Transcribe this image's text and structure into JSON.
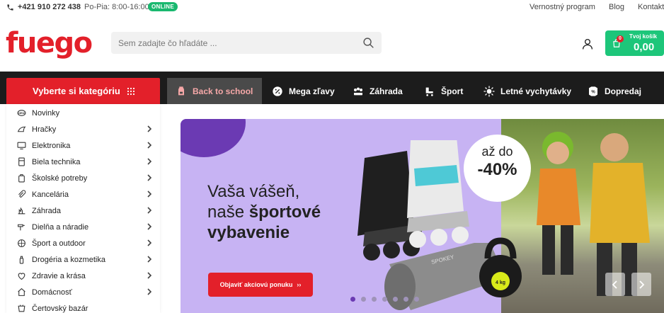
{
  "topbar": {
    "phone": "+421 910 272 438",
    "hours": "Po-Pia: 8:00-16:00",
    "online_badge": "ONLINE",
    "links": [
      "Vernostný program",
      "Blog",
      "Kontakt"
    ]
  },
  "header": {
    "logo": "fuego",
    "search_placeholder": "Sem zadajte čo hľadáte ...",
    "cart": {
      "title": "Tvoj košík",
      "total": "0,00",
      "count": "0"
    }
  },
  "nav": {
    "category_button": "Vyberte si kategóriu",
    "items": [
      {
        "label": "Back to school",
        "icon": "backpack-icon",
        "active": true
      },
      {
        "label": "Mega zľavy",
        "icon": "percent-badge-icon"
      },
      {
        "label": "Záhrada",
        "icon": "flowers-icon"
      },
      {
        "label": "Šport",
        "icon": "skate-icon"
      },
      {
        "label": "Letné vychytávky",
        "icon": "sun-icon"
      },
      {
        "label": "Dopredaj",
        "icon": "sale-tag-icon"
      }
    ]
  },
  "sidebar": {
    "items": [
      {
        "label": "Novinky",
        "icon": "new-icon",
        "has_children": false
      },
      {
        "label": "Hračky",
        "icon": "toy-icon",
        "has_children": true
      },
      {
        "label": "Elektronika",
        "icon": "monitor-icon",
        "has_children": true
      },
      {
        "label": "Biela technika",
        "icon": "fridge-icon",
        "has_children": true
      },
      {
        "label": "Školské potreby",
        "icon": "school-bag-icon",
        "has_children": true
      },
      {
        "label": "Kancelária",
        "icon": "paperclip-icon",
        "has_children": true
      },
      {
        "label": "Záhrada",
        "icon": "garden-icon",
        "has_children": true
      },
      {
        "label": "Dielňa a náradie",
        "icon": "tools-icon",
        "has_children": true
      },
      {
        "label": "Šport a outdoor",
        "icon": "ball-icon",
        "has_children": true
      },
      {
        "label": "Drogéria a kozmetika",
        "icon": "cosmetics-icon",
        "has_children": true
      },
      {
        "label": "Zdravie a krása",
        "icon": "health-icon",
        "has_children": true
      },
      {
        "label": "Domácnosť",
        "icon": "home-icon",
        "has_children": true
      },
      {
        "label": "Čertovský bazár",
        "icon": "bazaar-icon",
        "has_children": false
      }
    ]
  },
  "banner": {
    "headline_line1": "Vaša vášeň,",
    "headline_line2_regular": "naše",
    "headline_line2_bold": "športové",
    "headline_line3": "vybavenie",
    "discount_prefix": "až do",
    "discount_value": "-40%",
    "cta_label": "Objaviť akciovú ponuku",
    "cta_arrow": "››",
    "slide_count": 7,
    "active_slide": 0,
    "kettlebell_label": "4 kg",
    "brand_on_mat": "SPOKEY"
  },
  "colors": {
    "brand_red": "#e3202a",
    "cart_green": "#1dc67a",
    "nav_dark": "#1c1c1c",
    "banner_purple": "#c7b3f3",
    "accent_purple": "#6b3ab3"
  }
}
